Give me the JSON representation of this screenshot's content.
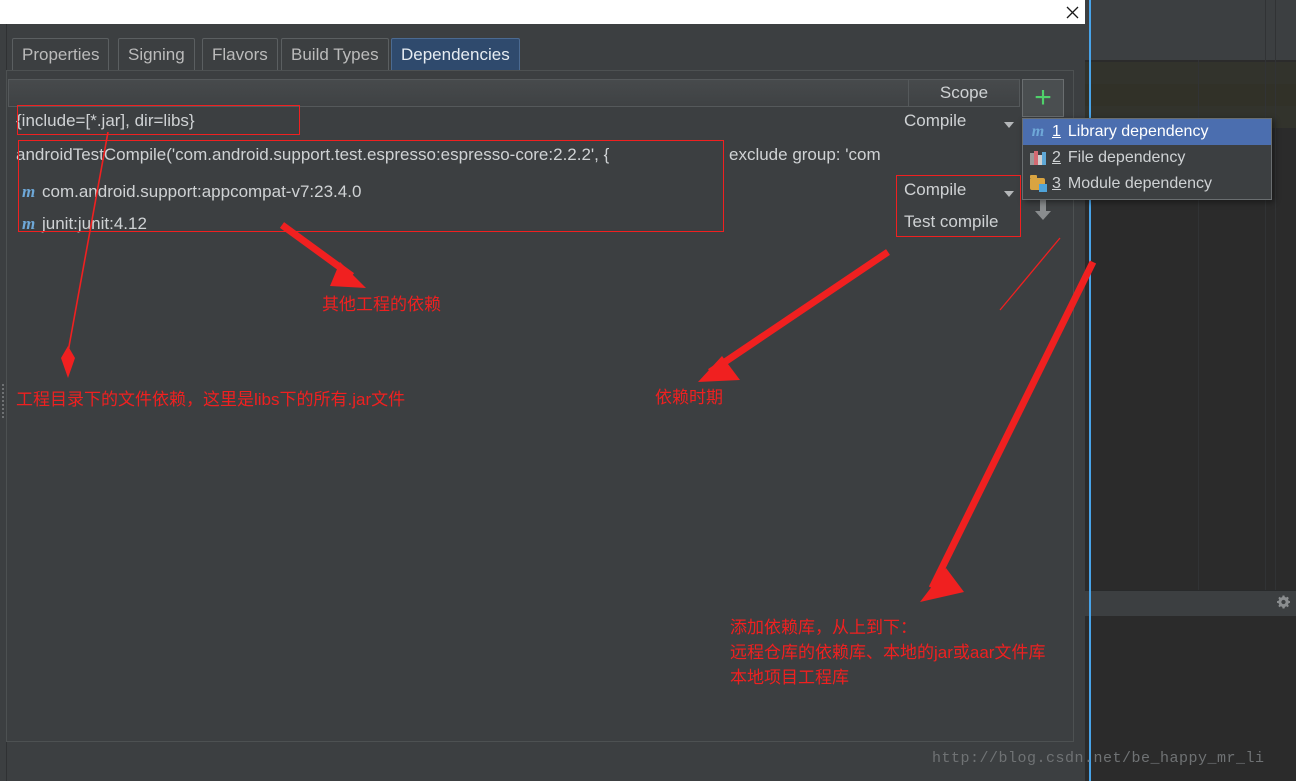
{
  "window": {
    "close_icon": "close-icon",
    "title_strip_color": "#ffffff"
  },
  "tabs": [
    {
      "label": "Properties",
      "active": false
    },
    {
      "label": "Signing",
      "active": false
    },
    {
      "label": "Flavors",
      "active": false
    },
    {
      "label": "Build Types",
      "active": false
    },
    {
      "label": "Dependencies",
      "active": true
    }
  ],
  "table": {
    "headers": [
      "",
      "Scope"
    ],
    "rows": [
      {
        "icon": "",
        "text": "{include=[*.jar], dir=libs}",
        "scope": "Compile",
        "scope_has_caret": true
      },
      {
        "icon": "",
        "text": "androidTestCompile('com.android.support.test.espresso:espresso-core:2.2.2', {",
        "trailing": "exclude group: 'com",
        "scope": "",
        "scope_has_caret": false
      },
      {
        "icon": "m",
        "text": "com.android.support:appcompat-v7:23.4.0",
        "scope": "Compile",
        "scope_has_caret": true
      },
      {
        "icon": "m",
        "text": "junit:junit:4.12",
        "scope": "Test compile",
        "scope_has_caret": false
      }
    ]
  },
  "toolbar": {
    "add_label": "+",
    "add_icon": "plus-icon",
    "down_icon": "arrow-down-icon"
  },
  "popup": {
    "items": [
      {
        "icon": "maven-m-icon",
        "num": "1",
        "label": "Library dependency",
        "selected": true
      },
      {
        "icon": "books-icon",
        "num": "2",
        "label": "File dependency",
        "selected": false
      },
      {
        "icon": "folder-module-icon",
        "num": "3",
        "label": "Module dependency",
        "selected": false
      }
    ]
  },
  "annotations": {
    "accent_color": "#ef2020",
    "note_other_project": "其他工程的依赖",
    "note_file_dep": "工程目录下的文件依赖，这里是libs下的所有.jar文件",
    "note_scope": "依赖时期",
    "note_add": "添加依赖库，从上到下：\n远程仓库的依赖库、本地的jar或aar文件库\n本地项目工程库"
  },
  "watermark": "http://blog.csdn.net/be_happy_mr_li"
}
